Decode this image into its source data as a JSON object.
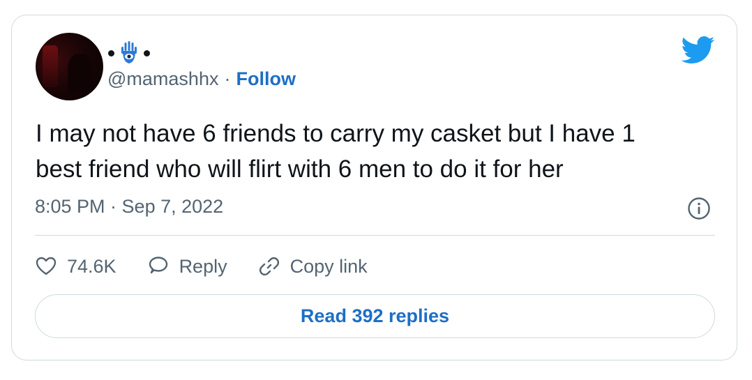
{
  "tweet": {
    "handle": "@mamashhx",
    "separator": "·",
    "follow_label": "Follow",
    "text_line1": "I may not have 6 friends to carry my casket but I have 1",
    "text_line2": "best friend who will flirt with 6 men to do it for her",
    "timestamp": "8:05 PM · Sep 7, 2022",
    "likes": "74.6K",
    "reply_label": "Reply",
    "copy_link_label": "Copy link",
    "read_replies_label": "Read 392 replies"
  },
  "icons": {
    "display_name": "hamsa-icon",
    "brand": "twitter-bird-icon",
    "info": "info-icon",
    "like": "heart-icon",
    "reply": "reply-bubble-icon",
    "link": "link-icon"
  },
  "colors": {
    "accent": "#1d6fc5",
    "brand": "#1d9bf0",
    "muted": "#536471",
    "border": "#cfd9de",
    "text": "#0f1419"
  }
}
